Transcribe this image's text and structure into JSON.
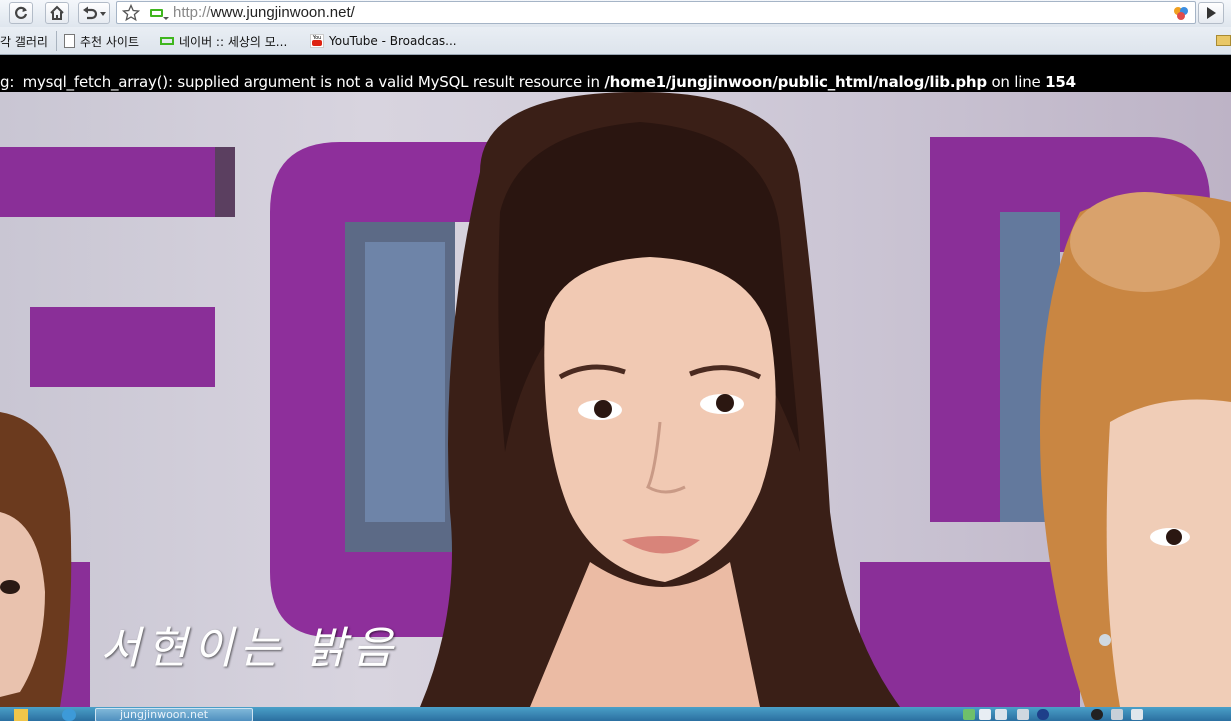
{
  "browser": {
    "url_scheme": "http://",
    "url_host": "www.jungjinwoon.net/",
    "icons": {
      "back": "refresh-icon",
      "home": "home-icon",
      "undo": "undo-icon",
      "star": "star-icon",
      "page": "page-arrow-icon"
    }
  },
  "bookmarks": [
    {
      "label": "각 갤러리",
      "icon": "none"
    },
    {
      "label": "추천 사이트",
      "icon": "document-icon"
    },
    {
      "label": "네이버 :: 세상의 모...",
      "icon": "naver-icon"
    },
    {
      "label": "YouTube - Broadcas...",
      "icon": "youtube-icon"
    }
  ],
  "error": {
    "lead": "g:",
    "message": " mysql_fetch_array(): supplied argument is not a valid MySQL result resource in ",
    "path": "/home1/jungjinwoon/public_html/nalog/lib.php",
    "line_label": " on line ",
    "line_number": "154"
  },
  "photo": {
    "caption": "서현이는 밝음"
  },
  "taskbar": {
    "window_title": "jungjinwoon.net"
  },
  "colors": {
    "accent_green": "#3fb61e",
    "error_bg": "#000000",
    "taskbar": "#2b6fa0"
  }
}
